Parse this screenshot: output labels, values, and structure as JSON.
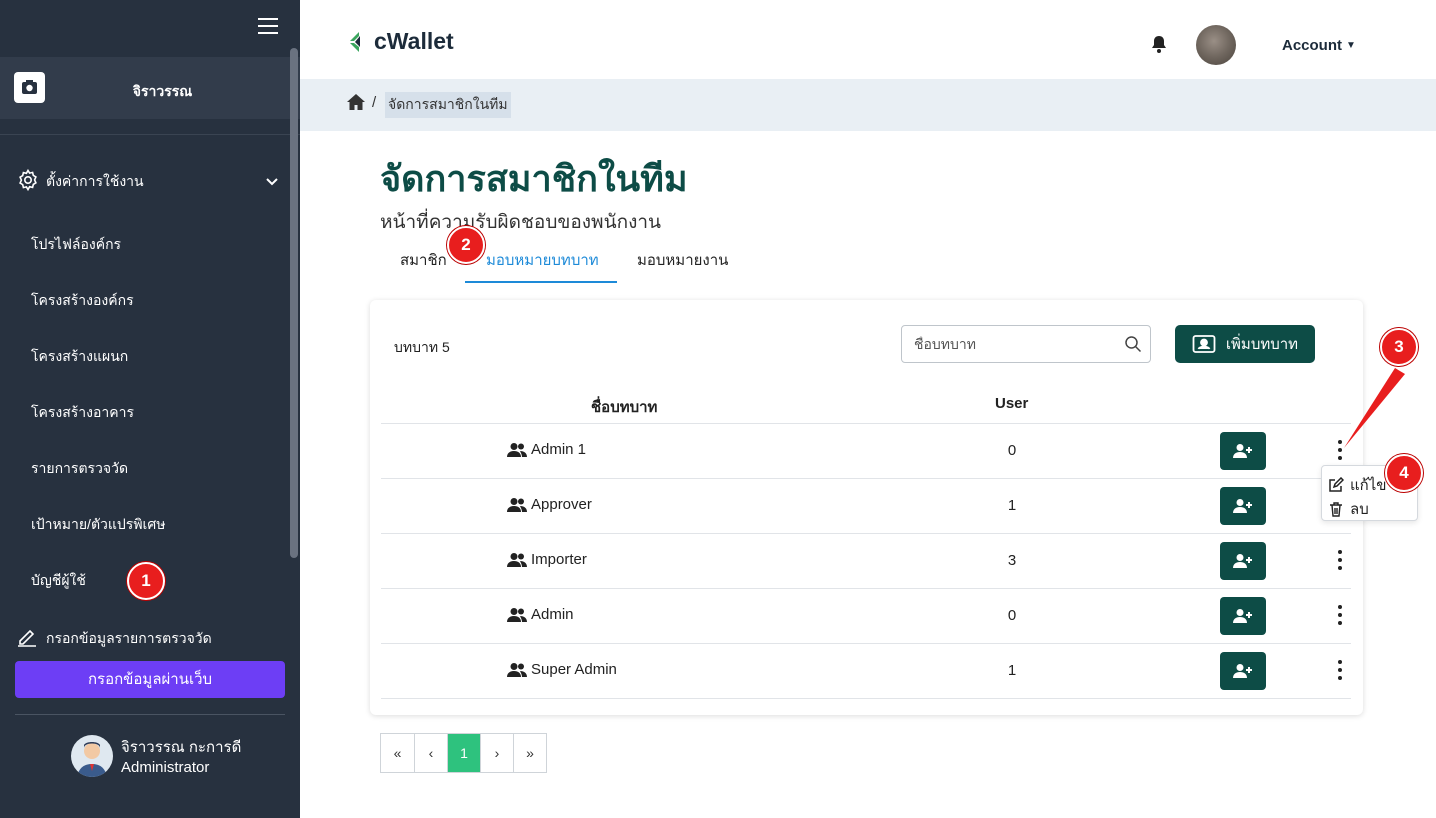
{
  "sidebar": {
    "user_name": "จิราวรรณ",
    "settings_label": "ตั้งค่าการใช้งาน",
    "items": [
      {
        "label": "โปรไฟล์องค์กร"
      },
      {
        "label": "โครงสร้างองค์กร"
      },
      {
        "label": "โครงสร้างแผนก"
      },
      {
        "label": "โครงสร้างอาคาร"
      },
      {
        "label": "รายการตรวจวัด"
      },
      {
        "label": "เป้าหมาย/ตัวแปรพิเศษ"
      },
      {
        "label": "บัญชีผู้ใช้"
      }
    ],
    "fill_label": "กรอกข้อมูลรายการตรวจวัด",
    "web_button": "กรอกข้อมูลผ่านเว็บ",
    "profile": {
      "name": "จิราวรรณ กะการดี",
      "role": "Administrator"
    }
  },
  "header": {
    "logo": "cWallet",
    "account_label": "Account"
  },
  "breadcrumb": {
    "separator": "/",
    "current": "จัดการสมาชิกในทีม"
  },
  "page": {
    "title": "จัดการสมาชิกในทีม",
    "subtitle": "หน้าที่ความรับผิดชอบของพนักงาน"
  },
  "tabs": [
    {
      "label": "สมาชิก",
      "active": false
    },
    {
      "label": "มอบหมายบทบาท",
      "active": true
    },
    {
      "label": "มอบหมายงาน",
      "active": false
    }
  ],
  "roles": {
    "count_label": "บทบาท 5",
    "search_placeholder": "ชื่อบทบาท",
    "add_button": "เพิ่มบทบาท",
    "columns": {
      "name": "ชื่อบทบาท",
      "user": "User"
    },
    "rows": [
      {
        "name": "Admin 1",
        "users": "0"
      },
      {
        "name": "Approver",
        "users": "1"
      },
      {
        "name": "Importer",
        "users": "3"
      },
      {
        "name": "Admin",
        "users": "0"
      },
      {
        "name": "Super Admin",
        "users": "1"
      }
    ],
    "menu": {
      "edit": "แก้ไข",
      "delete": "ลบ"
    }
  },
  "pagination": {
    "first": "«",
    "prev": "‹",
    "current": "1",
    "next": "›",
    "last": "»"
  },
  "callouts": [
    "1",
    "2",
    "3",
    "4"
  ],
  "colors": {
    "sidebar": "#27313f",
    "brand": "#0d4c46",
    "accent_tab": "#1d8ad8",
    "web_button": "#6d3ef5",
    "page_active": "#2ec27e",
    "callout": "#e81e1e"
  }
}
